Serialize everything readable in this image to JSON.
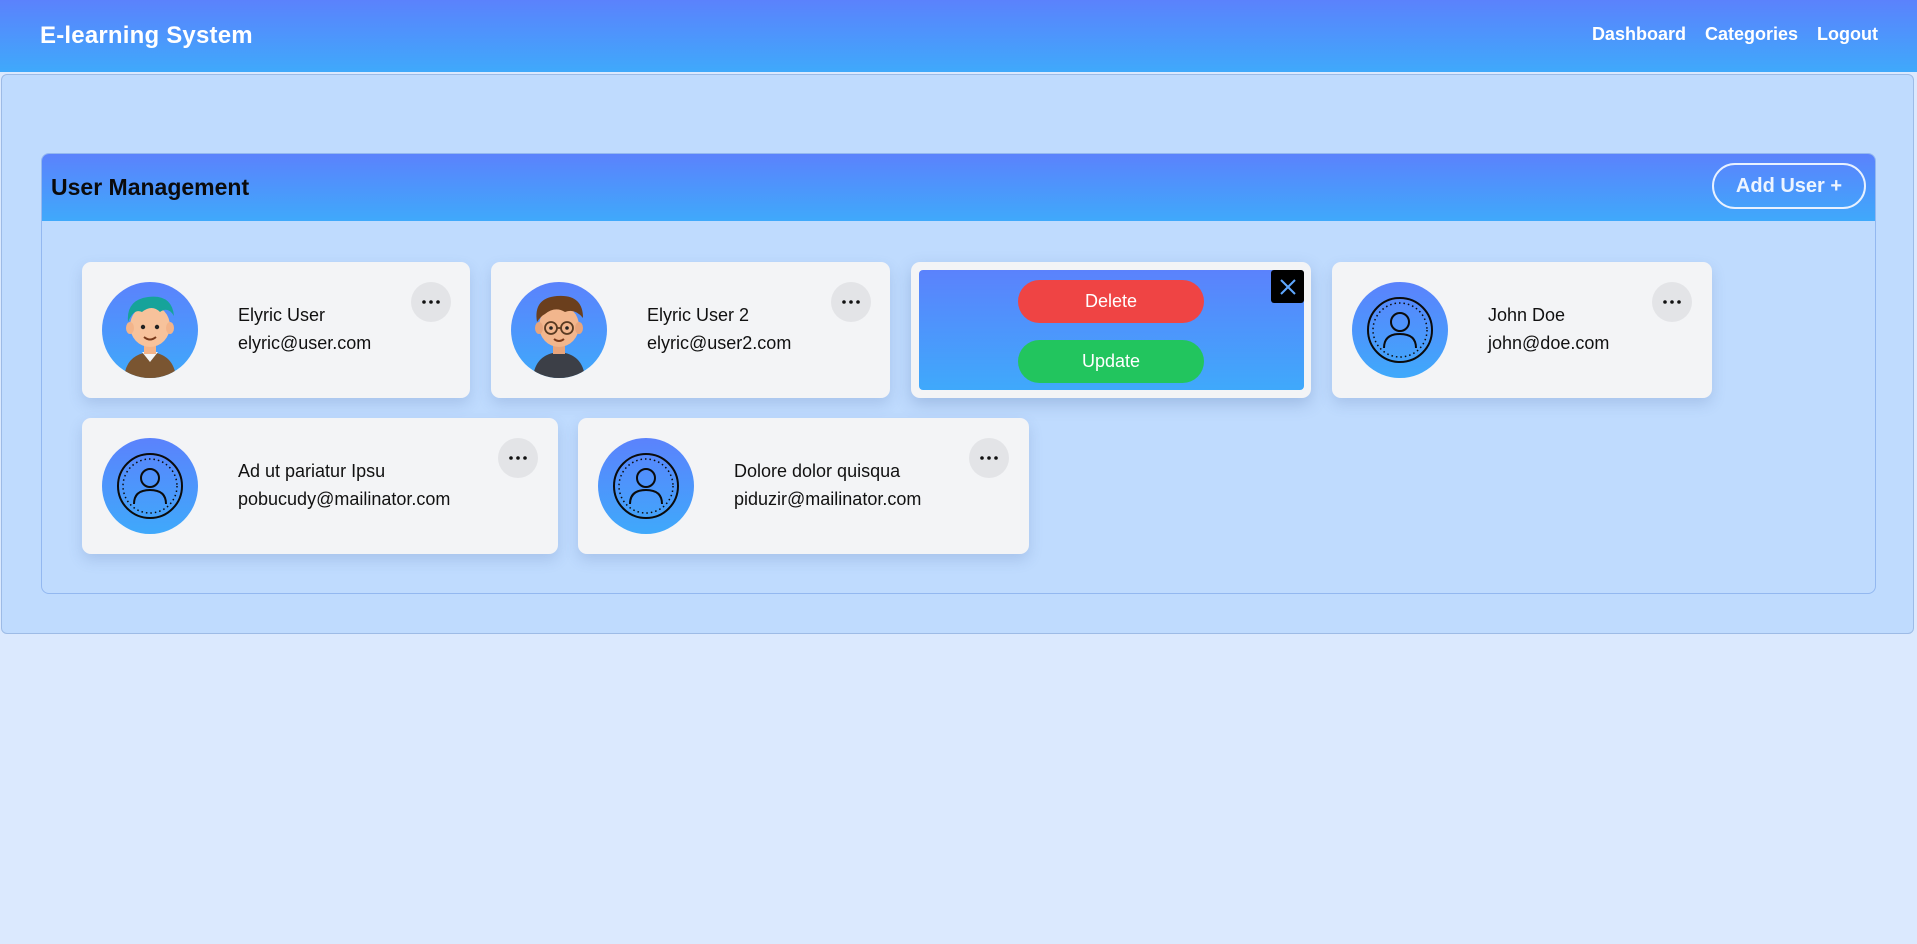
{
  "app": {
    "title": "E-learning System"
  },
  "nav": {
    "links": [
      "Dashboard",
      "Categories",
      "Logout"
    ]
  },
  "section": {
    "title": "User Management",
    "add_button": "Add User +"
  },
  "users": [
    {
      "name": "Elyric User",
      "email": "elyric@user.com",
      "avatar": "cartoon-boy-teal-hair"
    },
    {
      "name": "Elyric User 2",
      "email": "elyric@user2.com",
      "avatar": "cartoon-boy-glasses"
    },
    {
      "name": "John Doe",
      "email": "john@doe.com",
      "avatar": "default-user-icon"
    },
    {
      "name": "Ad ut pariatur Ipsu",
      "email": "pobucudy@mailinator.com",
      "avatar": "default-user-icon"
    },
    {
      "name": "Dolore dolor quisqua",
      "email": "piduzir@mailinator.com",
      "avatar": "default-user-icon"
    }
  ],
  "action_menu": {
    "delete_label": "Delete",
    "update_label": "Update",
    "close_icon": "close-icon"
  },
  "icons": {
    "more": "more-horizontal-icon",
    "user": "user-circle-icon"
  },
  "colors": {
    "gradient_top": "#5b82fc",
    "gradient_bottom": "#3fa9fb",
    "delete": "#ef4444",
    "update": "#22c55e",
    "page_bg": "#dbe9fe",
    "panel_bg": "#bfdbfe",
    "card_bg": "#f3f4f6"
  }
}
